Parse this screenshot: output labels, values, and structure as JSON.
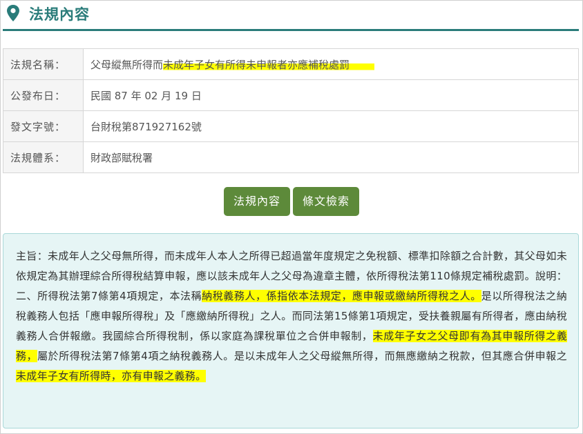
{
  "header": {
    "title": "法規內容",
    "icon": "map-pin-icon",
    "accent": "#2a7c7a"
  },
  "info": [
    {
      "label": "法規名稱：",
      "value_plain": "父母縱無所得而",
      "value_highlight": "未成年子女有所得未申報者亦應補稅處罰"
    },
    {
      "label": "公發布日：",
      "value": "民國 87 年 02 月 19 日"
    },
    {
      "label": "發文字號：",
      "value": "台財稅第871927162號"
    },
    {
      "label": "法規體系：",
      "value": "財政部賦稅署"
    }
  ],
  "buttons": {
    "content": "法規內容",
    "search": "條文檢索",
    "color": "#5d8a3a"
  },
  "body": {
    "seg1": "主旨：未成年人之父母無所得，而未成年人本人之所得已超過當年度規定之免稅額、標準扣除額之合計數，其父母如未依規定為其辦理綜合所得稅結算申報，應以該未成年人之父母為違章主體，依所得稅法第110條規定補稅處罰。說明：二、所得稅法第7條第4項規定，本法稱",
    "hl1": "納稅義務人，係指依本法規定，應申報或繳納所得稅之人。",
    "seg2": "是以所得稅法之納稅義務人包括「應申報所得稅」及「應繳納所得稅」之人。而同法第15條第1項規定，受扶養親屬有所得者，應由納稅義務人合併報繳。我國綜合所得稅制，係以家庭為課稅單位之合併申報制，",
    "hl2": "未成年子女之父母即有為其申報所得之義務，",
    "seg3": "屬於所得稅法第7條第4項之納稅義務人。是以未成年人之父母縱無所得，而無應繳納之稅款，但其應合併申報之",
    "hl3": "未成年子女有所得時，亦有申報之義務。",
    "panel_bg": "#e6f5f5"
  }
}
